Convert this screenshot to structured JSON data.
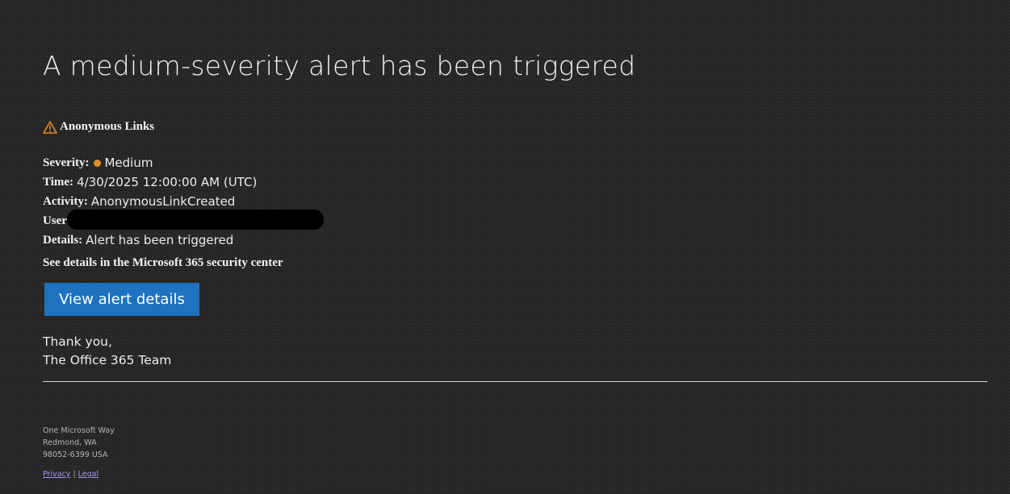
{
  "email": {
    "title": "A medium-severity alert has been triggered",
    "alert_name": "Anonymous Links",
    "details": {
      "severity_label": "Severity:",
      "severity_value": "Medium",
      "severity_color": "#e8892a",
      "time_label": "Time:",
      "time_value": "4/30/2025 12:00:00 AM (UTC)",
      "activity_label": "Activity:",
      "activity_value": "AnonymousLinkCreated",
      "user_label": "User",
      "details_label": "Details:",
      "details_value": "Alert has been triggered"
    },
    "security_center_note": "See details in the Microsoft 365 security center",
    "button_label": "View alert details",
    "button_color": "#1e72c0",
    "signoff_line1": "Thank you,",
    "signoff_line2": "The Office 365 Team"
  },
  "footer": {
    "address_line1": "One Microsoft Way",
    "address_line2": "Redmond, WA",
    "address_line3": "98052-6399 USA",
    "privacy_link": "Privacy",
    "separator": "|",
    "legal_link": "Legal"
  },
  "icons": {
    "warning": "warning-triangle-icon"
  }
}
